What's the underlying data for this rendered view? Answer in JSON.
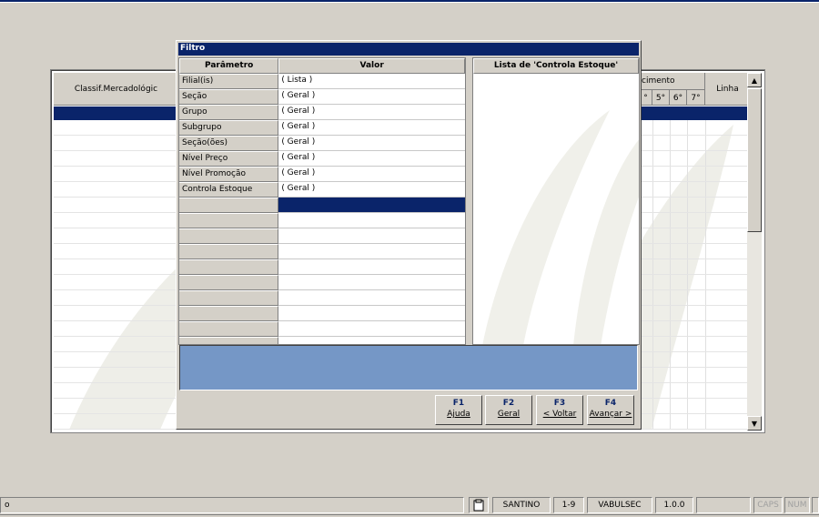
{
  "background_grid": {
    "columns": {
      "classif": "Classif.Mercadológic",
      "vencimento_group": "cimento",
      "day_cols": [
        "°",
        "5°",
        "6°",
        "7°"
      ],
      "linha": "Linha"
    }
  },
  "dialog": {
    "title": "Filtro",
    "param_header": "Parâmetro",
    "value_header": "Valor",
    "rows": [
      {
        "param": "Filial(is)",
        "value": "( Lista )"
      },
      {
        "param": "Seção",
        "value": "( Geral )"
      },
      {
        "param": "Grupo",
        "value": "( Geral )"
      },
      {
        "param": "Subgrupo",
        "value": "( Geral )"
      },
      {
        "param": "Seção(ões)",
        "value": "( Geral )"
      },
      {
        "param": "Nível Preço",
        "value": "( Geral )"
      },
      {
        "param": "Nível Promoção",
        "value": "( Geral )"
      },
      {
        "param": "Controla Estoque",
        "value": "( Geral )"
      }
    ],
    "list_title": "Lista de 'Controla Estoque'",
    "buttons": [
      {
        "key": "F1",
        "label": "Ajuda"
      },
      {
        "key": "F2",
        "label": "Geral"
      },
      {
        "key": "F3",
        "label": "< Voltar"
      },
      {
        "key": "F4",
        "label": "Avançar >"
      }
    ]
  },
  "status_bar": {
    "left_text": "o",
    "user": "SANTINO",
    "range": "1-9",
    "module": "VABULSEC",
    "version": "1.0.0",
    "caps": "CAPS",
    "num": "NUM"
  },
  "colors": {
    "selection": "#0a246a",
    "info_bar": "#7597c6",
    "window_bg": "#d4d0c8"
  }
}
